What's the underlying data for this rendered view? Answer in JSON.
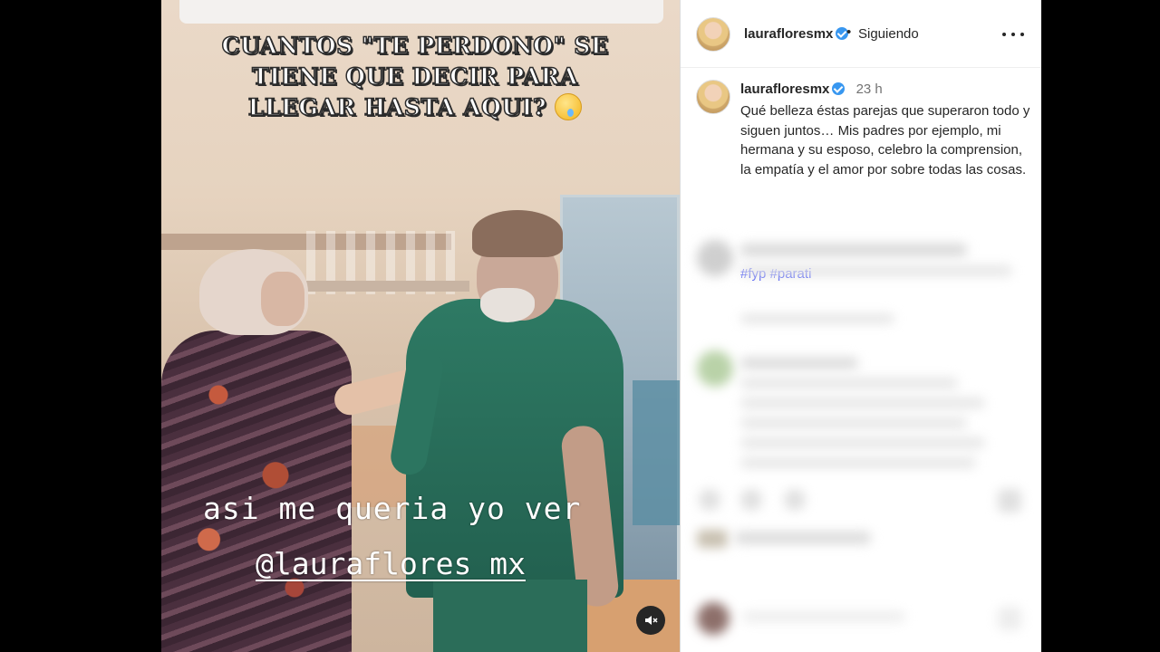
{
  "video": {
    "heading_lines": [
      "CUANTOS \"TE PERDONO\" SE",
      "TIENE QUE DECIR PARA",
      "LLEGAR HASTA AQUI?"
    ],
    "caption_line1": "asi me queria yo ver",
    "caption_line2": "@lauraflores mx",
    "mute_icon": "muted-speaker-icon"
  },
  "header": {
    "username": "laurafloresmx",
    "separator": "•",
    "follow_status": "Siguiendo",
    "more_icon": "more-options-icon"
  },
  "post": {
    "username": "laurafloresmx",
    "time": "23 h",
    "caption": "Qué belleza éstas parejas que superaron todo y siguen juntos… Mis padres por ejemplo, mi hermana y su esposo, celebro la comprension, la empatía y el amor por sobre todas las cosas.",
    "hashtags": [
      "#fyp",
      "#parati"
    ],
    "link_color": "#4150f7"
  }
}
